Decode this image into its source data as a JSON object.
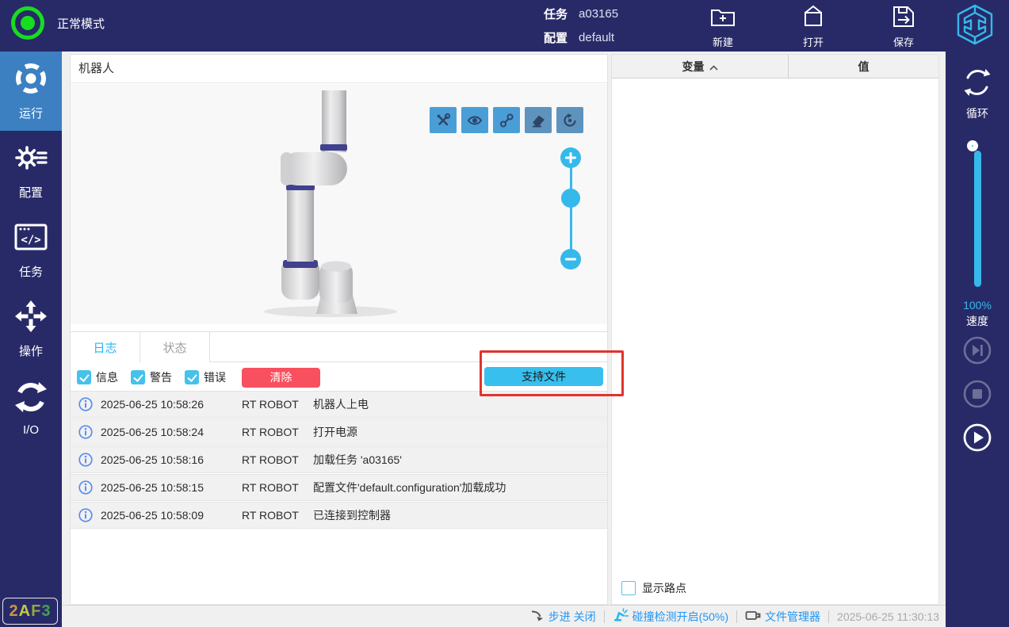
{
  "colors": {
    "navy": "#282a68",
    "sidebar_active_blue": "#3c80c2",
    "accent_cyan": "#38bfee",
    "toolbar_button_blue": "#4a9ed7",
    "tab_active_text": "#29b6f2",
    "clear_button_red": "#f8505f",
    "highlight_annotation_red": "#e0332c",
    "status_green": "#17dd20",
    "statusbar_link_blue": "#2196f3",
    "info_icon_blue": "#5b8def",
    "logo_cyan": "#35b9ea"
  },
  "header": {
    "mode": "正常模式",
    "task_label": "任务",
    "task_value": "a03165",
    "config_label": "配置",
    "config_value": "default",
    "actions": [
      {
        "label": "新建",
        "icon": "new-file-icon"
      },
      {
        "label": "打开",
        "icon": "open-file-icon"
      },
      {
        "label": "保存",
        "icon": "save-icon"
      }
    ]
  },
  "sidebar": {
    "items": [
      {
        "label": "运行",
        "icon": "run-icon",
        "active": true
      },
      {
        "label": "配置",
        "icon": "settings-gear-icon",
        "active": false
      },
      {
        "label": "任务",
        "icon": "task-code-icon",
        "active": false
      },
      {
        "label": "操作",
        "icon": "move-arrows-icon",
        "active": false
      },
      {
        "label": "I/O",
        "icon": "io-cycle-icon",
        "active": false
      }
    ],
    "badge_chars": [
      "2",
      "A",
      "F",
      "3"
    ]
  },
  "robot_panel": {
    "title": "机器人",
    "viewer_tools": [
      "tools-icon",
      "eye-icon",
      "waypoint-path-icon",
      "eraser-icon",
      "reset-view-icon"
    ],
    "tabs": [
      {
        "label": "日志",
        "active": true
      },
      {
        "label": "状态",
        "active": false
      }
    ],
    "filters": [
      {
        "label": "信息",
        "checked": true
      },
      {
        "label": "警告",
        "checked": true
      },
      {
        "label": "错误",
        "checked": true
      }
    ],
    "clear_label": "清除",
    "support_file_label": "支持文件",
    "log": [
      {
        "time": "2025-06-25 10:58:26",
        "source": "RT ROBOT",
        "message": "机器人上电"
      },
      {
        "time": "2025-06-25 10:58:24",
        "source": "RT ROBOT",
        "message": "打开电源"
      },
      {
        "time": "2025-06-25 10:58:16",
        "source": "RT ROBOT",
        "message": "加载任务 'a03165'"
      },
      {
        "time": "2025-06-25 10:58:15",
        "source": "RT ROBOT",
        "message": "配置文件'default.configuration'加载成功"
      },
      {
        "time": "2025-06-25 10:58:09",
        "source": "RT ROBOT",
        "message": "已连接到控制器"
      }
    ]
  },
  "variables_panel": {
    "columns": [
      {
        "label": "变量",
        "sorted": "asc"
      },
      {
        "label": "值"
      }
    ],
    "show_waypoints": {
      "label": "显示路点",
      "checked": false
    }
  },
  "right_sidebar": {
    "loop_label": "循环",
    "speed_value": "100%",
    "speed_label": "速度"
  },
  "status_bar": {
    "step_label": "步进 关闭",
    "collision_label": "碰撞检测开启(50%)",
    "file_manager_label": "文件管理器",
    "timestamp": "2025-06-25 11:30:13"
  }
}
